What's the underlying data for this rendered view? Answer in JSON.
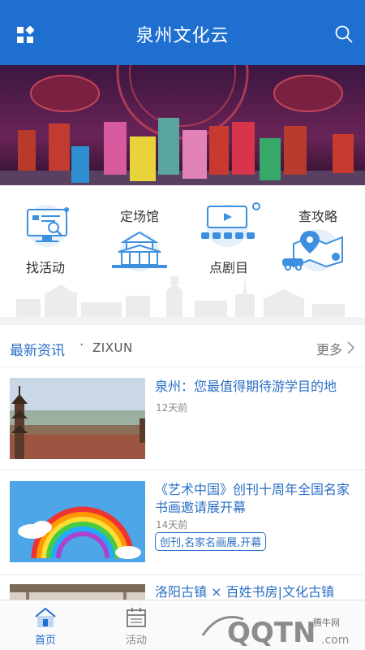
{
  "header": {
    "title": "泉州文化云",
    "menu_icon": "grid-icon",
    "search_icon": "search-icon"
  },
  "banner": {
    "image": "opera-stage-photo"
  },
  "categories": [
    {
      "label": "找活动",
      "icon": "monitor-search-icon"
    },
    {
      "label": "定场馆",
      "icon": "temple-icon"
    },
    {
      "label": "点剧目",
      "icon": "theater-screen-icon"
    },
    {
      "label": "查攻略",
      "icon": "map-location-icon"
    }
  ],
  "news_section": {
    "title": "最新资讯",
    "separator": "·",
    "subtitle": "ZIXUN",
    "more": "更多"
  },
  "news": [
    {
      "title": "泉州：您最值得期待游学目的地",
      "time": "12天前",
      "tag": ""
    },
    {
      "title": "《艺术中国》创刊十周年全国名家书画邀请展开幕",
      "time": "14天前",
      "tag": "创刊,名家名画展,开幕"
    },
    {
      "title": "洛阳古镇 × 百姓书房|文化古镇",
      "time": "",
      "tag": ""
    }
  ],
  "tabbar": {
    "items": [
      {
        "label": "首页",
        "icon": "home-icon",
        "active": true
      },
      {
        "label": "活动",
        "icon": "calendar-icon",
        "active": false
      }
    ]
  },
  "watermark": {
    "text": "QQTN",
    "small": "腾牛网"
  },
  "colors": {
    "brand": "#1f6fd0",
    "accent_text": "#2a6fc4",
    "icon_blue": "#3d8fe0"
  }
}
